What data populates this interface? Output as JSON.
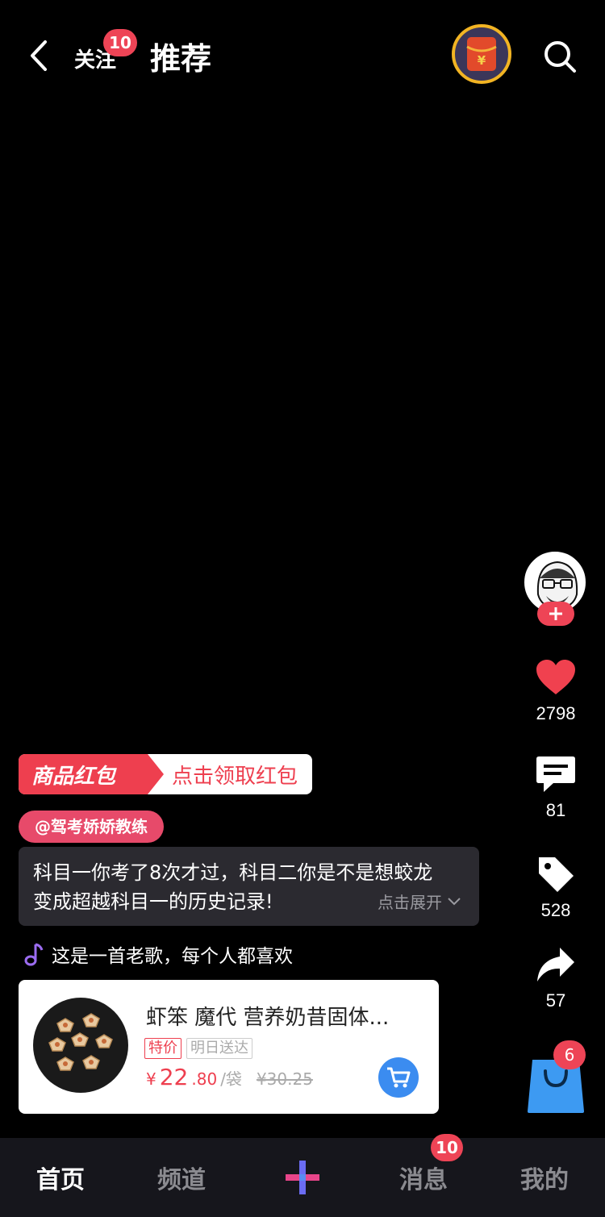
{
  "header": {
    "follow_label": "关注",
    "follow_badge": "10",
    "recommend_label": "推荐"
  },
  "rail": {
    "likes": "2798",
    "comments": "81",
    "tags": "528",
    "shares": "57",
    "cart_badge": "6"
  },
  "promo": {
    "tag": "商品红包",
    "text": "点击领取红包"
  },
  "author": "@驾考娇娇教练",
  "description": {
    "line1": "科目一你考了8次才过，科目二你是不是想蛟龙",
    "line2": "变成超越科目一的历史记录!",
    "expand": "点击展开"
  },
  "music": "这是一首老歌，每个人都喜欢",
  "product": {
    "title": "虾笨 魔代 营养奶昔固体...",
    "tag_special": "特价",
    "tag_delivery": "明日送达",
    "currency": "¥",
    "price_int": "22",
    "price_dec": ".80",
    "unit": "/袋",
    "original_price": "¥30.25"
  },
  "nav": {
    "home": "首页",
    "channel": "频道",
    "messages": "消息",
    "messages_badge": "10",
    "mine": "我的"
  },
  "colors": {
    "accent_red": "#ee4456",
    "ring_gold": "#f2b423",
    "cart_blue": "#3b8cf0"
  }
}
